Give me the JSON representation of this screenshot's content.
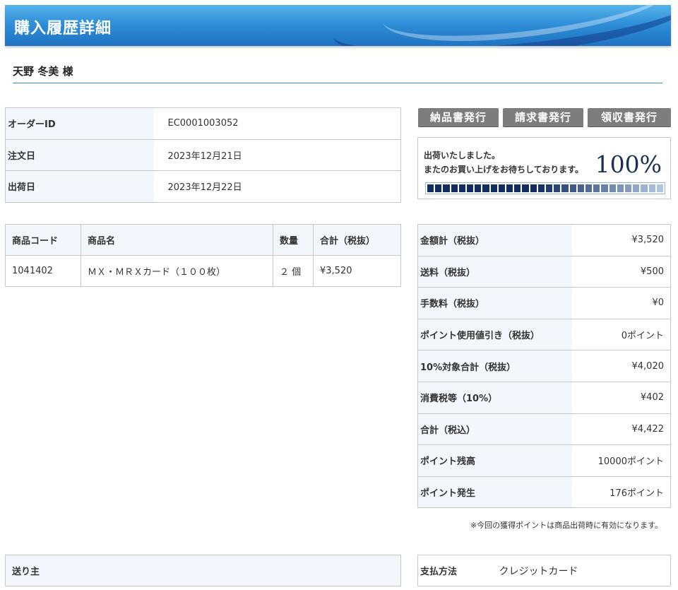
{
  "header": {
    "title": "購入履歴詳細"
  },
  "customer": {
    "name_line": "天野 冬美 様"
  },
  "order_info": {
    "rows": [
      {
        "label": "オーダーID",
        "value": "EC0001003052"
      },
      {
        "label": "注文日",
        "value": "2023年12月21日"
      },
      {
        "label": "出荷日",
        "value": "2023年12月22日"
      }
    ]
  },
  "documents": {
    "delivery_note": "納品書発行",
    "invoice": "請求書発行",
    "receipt": "領収書発行"
  },
  "shipping": {
    "message_1": "出荷いたしました。",
    "message_2": "またのお買い上げをお待ちしております。",
    "percent_text": "100%",
    "progress": 1.0,
    "colors": {
      "dark": "#132c64",
      "light": "#b9cfe6"
    }
  },
  "items_table": {
    "headers": {
      "code": "商品コード",
      "name": "商品名",
      "qty": "数量",
      "total": "合計（税抜）"
    },
    "rows": [
      {
        "code": "1041402",
        "name": "ＭＸ・ＭＲＸカード（１００枚）",
        "qty": "２ 個",
        "total": "¥3,520"
      }
    ]
  },
  "totals": {
    "rows": [
      {
        "label": "金額計（税抜）",
        "value": "¥3,520"
      },
      {
        "label": "送料（税抜）",
        "value": "¥500"
      },
      {
        "label": "手数料（税抜）",
        "value": "¥0"
      },
      {
        "label": "ポイント使用値引き（税抜）",
        "value": "0ポイント"
      },
      {
        "label": "10%対象合計（税抜）",
        "value": "¥4,020"
      },
      {
        "label": "消費税等（10%）",
        "value": "¥402"
      },
      {
        "label": "合計（税込）",
        "value": "¥4,422"
      },
      {
        "label": "ポイント残高",
        "value": "10000ポイント"
      },
      {
        "label": "ポイント発生",
        "value": "176ポイント"
      }
    ],
    "note": "※今回の獲得ポイントは商品出荷時に有効になります。"
  },
  "sender": {
    "header": "送り主"
  },
  "payment": {
    "label": "支払方法",
    "value": "クレジットカード"
  }
}
